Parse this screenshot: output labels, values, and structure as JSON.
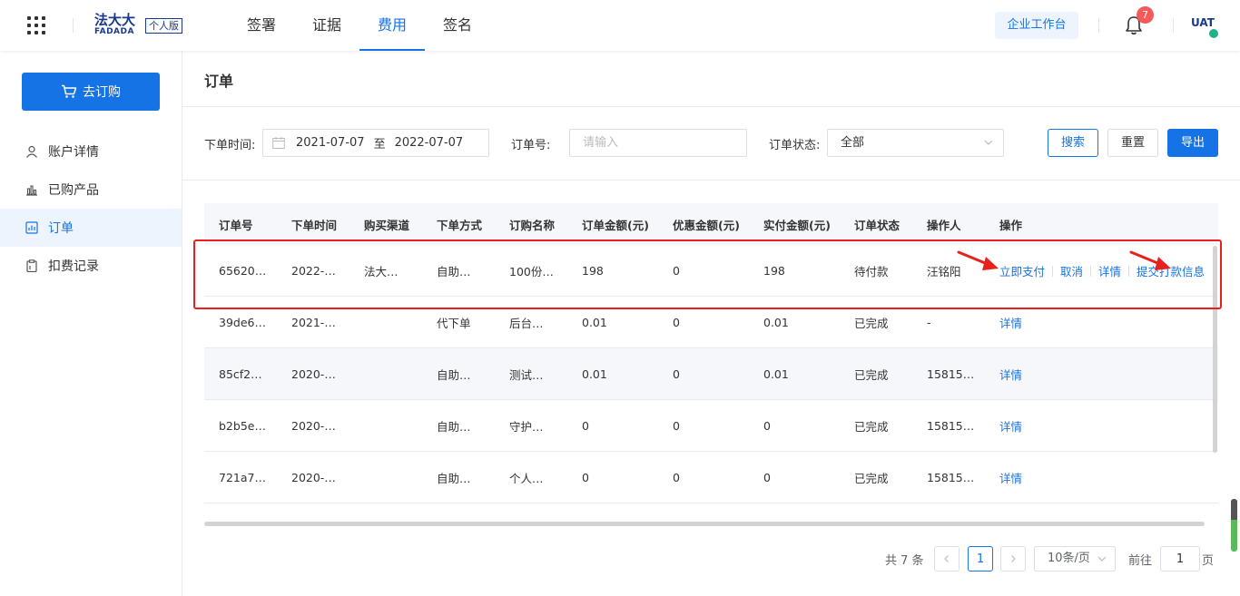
{
  "header": {
    "logo_cn": "法大大",
    "logo_en": "FADADA",
    "edition": "个人版",
    "nav": [
      {
        "label": "签署",
        "active": false
      },
      {
        "label": "证据",
        "active": false
      },
      {
        "label": "费用",
        "active": true
      },
      {
        "label": "签名",
        "active": false
      }
    ],
    "workspace_label": "企业工作台",
    "notification_count": "7",
    "avatar_text": "UAT"
  },
  "sidebar": {
    "order_button": "去订购",
    "items": [
      {
        "label": "账户详情",
        "icon": "user-icon",
        "active": false
      },
      {
        "label": "已购产品",
        "icon": "bar-chart-icon",
        "active": false
      },
      {
        "label": "订单",
        "icon": "order-chart-icon",
        "active": true
      },
      {
        "label": "扣费记录",
        "icon": "clipboard-icon",
        "active": false
      }
    ]
  },
  "main": {
    "title": "订单",
    "filters": {
      "date_label": "下单时间:",
      "date_start": "2021-07-07",
      "date_to": "至",
      "date_end": "2022-07-07",
      "order_no_label": "订单号:",
      "order_no_placeholder": "请输入",
      "status_label": "订单状态:",
      "status_value": "全部",
      "search": "搜索",
      "reset": "重置",
      "export": "导出"
    },
    "table": {
      "columns": [
        "订单号",
        "下单时间",
        "购买渠道",
        "下单方式",
        "订购名称",
        "订单金额(元)",
        "优惠金额(元)",
        "实付金额(元)",
        "订单状态",
        "操作人",
        "操作"
      ],
      "rows": [
        {
          "cells": [
            "65620…",
            "2022-…",
            "法大…",
            "自助…",
            "100份…",
            "198",
            "0",
            "198",
            "待付款",
            "汪铭阳"
          ],
          "actions": [
            "立即支付",
            "取消",
            "详情",
            "提交打款信息"
          ]
        },
        {
          "cells": [
            "39de6…",
            "2021-…",
            "",
            "代下单",
            "后台…",
            "0.01",
            "0",
            "0.01",
            "已完成",
            "-"
          ],
          "actions": [
            "详情"
          ]
        },
        {
          "cells": [
            "85cf2…",
            "2020-…",
            "",
            "自助…",
            "测试…",
            "0.01",
            "0",
            "0.01",
            "已完成",
            "15815…"
          ],
          "actions": [
            "详情"
          ]
        },
        {
          "cells": [
            "b2b5e…",
            "2020-…",
            "",
            "自助…",
            "守护…",
            "0",
            "0",
            "0",
            "已完成",
            "15815…"
          ],
          "actions": [
            "详情"
          ]
        },
        {
          "cells": [
            "721a7…",
            "2020-…",
            "",
            "自助…",
            "个人…",
            "0",
            "0",
            "0",
            "已完成",
            "15815…"
          ],
          "actions": [
            "详情"
          ]
        }
      ]
    },
    "pagination": {
      "total": "共 7 条",
      "current": "1",
      "page_size": "10条/页",
      "goto_label": "前往",
      "goto_value": "1",
      "page_unit": "页"
    }
  },
  "colors": {
    "primary": "#1673e6",
    "brand": "#1a3a8c",
    "annotation": "#e8211c",
    "badge": "#f55a5a"
  }
}
